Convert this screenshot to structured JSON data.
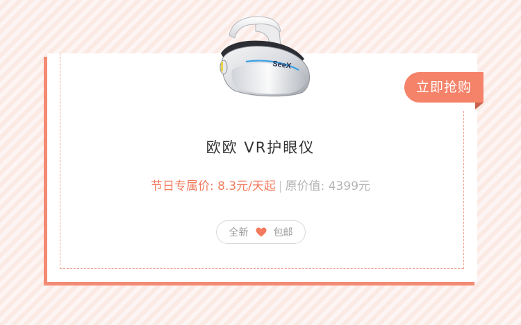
{
  "product": {
    "brand_logo_text": "SeeX",
    "title": "欧欧 VR护眼仪",
    "festival_price": "节日专属价: 8.3元/天起",
    "separator": "|",
    "original_price": "原价值: 4399元"
  },
  "badge": {
    "label": "立即抢购"
  },
  "tags": {
    "left": "全新",
    "icon": "heart-icon",
    "right": "包邮"
  },
  "colors": {
    "accent": "#f5836a",
    "price": "#f37a5e",
    "background": "#fbe9e4"
  }
}
